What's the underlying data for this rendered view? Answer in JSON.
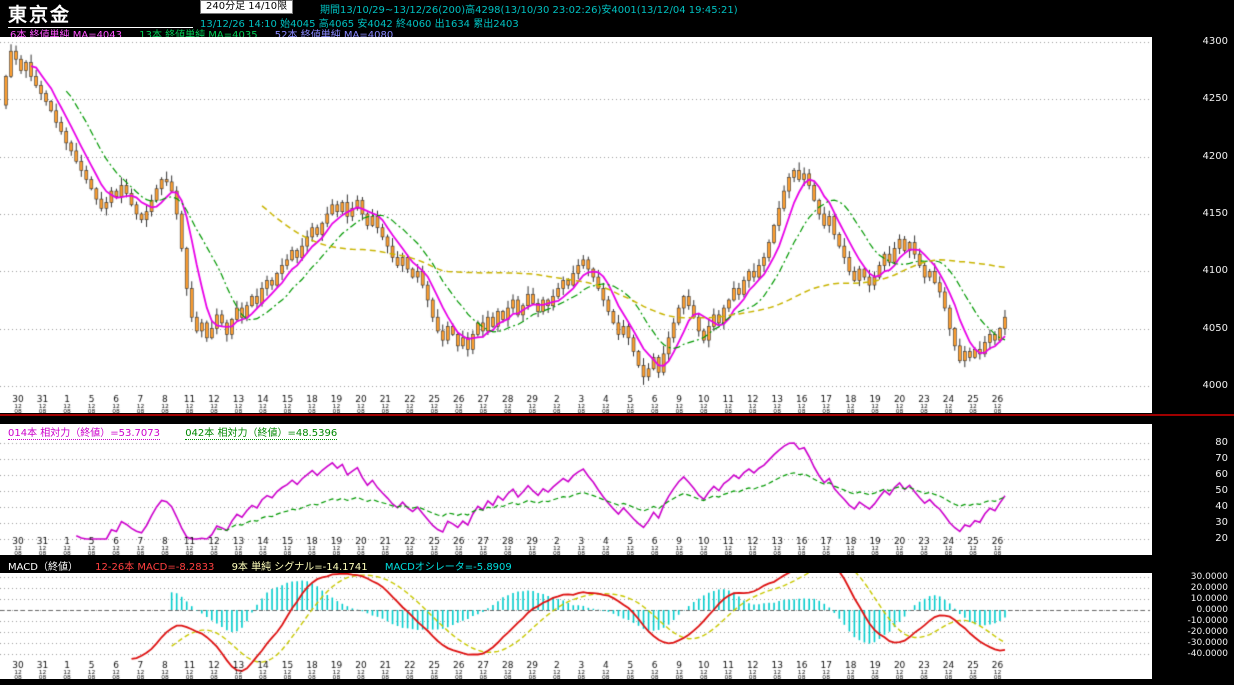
{
  "header": {
    "title": "東京金",
    "timeframe_box": "240分足 14/10限",
    "period_line": "期間13/10/29~13/12/26(200)高4298(13/10/30 23:02:26)安4001(13/12/04 19:45:21)",
    "quote_line": "13/12/26 14:10 始4045 高4065 安4042 終4060 出1634 累出2403",
    "ma_legend": [
      {
        "label": "6本 終値単純 MA=4043",
        "color": "#ff55ff"
      },
      {
        "label": "13本 終値単純 MA=4035",
        "color": "#00cc55"
      },
      {
        "label": "52本 終値単純 MA=4080",
        "color": "#8888ff"
      }
    ]
  },
  "rsi_header": [
    {
      "label": "014本 相対力（終値）=53.7073",
      "color": "#cc00cc"
    },
    {
      "label": "042本 相対力（終値）=48.5396",
      "color": "#008800"
    }
  ],
  "macd_header": {
    "title": "MACD（終値）",
    "items": [
      {
        "label": "12-26本 MACD=-8.2833",
        "color": "#ff4040"
      },
      {
        "label": "9本 単純 シグナル=-14.1741",
        "color": "#ffffbb"
      },
      {
        "label": "MACDオシレータ=-5.8909",
        "color": "#00dddd"
      }
    ]
  },
  "colors": {
    "background": "#000000",
    "panel_bg": "#ffffff",
    "teal_text": "#00c0c0",
    "grid": "#999999",
    "separator_red": "#a00000",
    "candle_fill": "#ffa030",
    "candle_border": "#333333",
    "ma_lines": [
      "#e800e8",
      "#009900",
      "#c8b400"
    ],
    "rsi_lines": [
      "#cc00cc",
      "#009900"
    ],
    "macd_line": "#dd1111",
    "macd_signal": "#c8c800",
    "macd_hist": "#00cccc",
    "axis_label": "#f0f0f0",
    "tick_label": "#111111"
  },
  "chart_data": {
    "type": "candlestick",
    "title": "東京金 240分足 14/10限",
    "panels": [
      {
        "name": "price",
        "type": "candlestick",
        "ylim": [
          4000,
          4300
        ],
        "ytick_step": 50,
        "ma_periods": [
          6,
          13,
          52
        ]
      },
      {
        "name": "rsi",
        "type": "line",
        "ylim": [
          20,
          80
        ],
        "ytick_step": 10,
        "periods": [
          14,
          42
        ]
      },
      {
        "name": "macd",
        "type": "line+histogram",
        "ylim": [
          -40,
          30
        ],
        "ytick_step": 10,
        "fast": 12,
        "slow": 26,
        "signal": 9
      }
    ],
    "first_open": 4245,
    "closes": [
      4270,
      4292,
      4285,
      4275,
      4282,
      4270,
      4262,
      4255,
      4248,
      4240,
      4230,
      4222,
      4212,
      4205,
      4196,
      4188,
      4180,
      4172,
      4163,
      4155,
      4160,
      4170,
      4165,
      4175,
      4168,
      4158,
      4150,
      4145,
      4152,
      4162,
      4172,
      4180,
      4178,
      4170,
      4150,
      4120,
      4085,
      4060,
      4048,
      4055,
      4042,
      4050,
      4062,
      4055,
      4045,
      4058,
      4068,
      4060,
      4070,
      4078,
      4072,
      4085,
      4092,
      4088,
      4098,
      4105,
      4110,
      4118,
      4112,
      4122,
      4130,
      4138,
      4132,
      4142,
      4150,
      4158,
      4152,
      4160,
      4148,
      4155,
      4162,
      4150,
      4140,
      4148,
      4138,
      4130,
      4122,
      4112,
      4105,
      4112,
      4102,
      4095,
      4100,
      4088,
      4075,
      4060,
      4048,
      4040,
      4052,
      4045,
      4035,
      4042,
      4032,
      4045,
      4055,
      4048,
      4060,
      4052,
      4065,
      4058,
      4068,
      4075,
      4062,
      4070,
      4080,
      4072,
      4065,
      4075,
      4070,
      4078,
      4085,
      4092,
      4088,
      4098,
      4105,
      4110,
      4102,
      4095,
      4085,
      4075,
      4065,
      4055,
      4045,
      4052,
      4042,
      4030,
      4018,
      4008,
      4015,
      4025,
      4012,
      4028,
      4042,
      4055,
      4068,
      4078,
      4070,
      4060,
      4048,
      4040,
      4052,
      4062,
      4055,
      4068,
      4075,
      4085,
      4080,
      4092,
      4100,
      4095,
      4105,
      4112,
      4125,
      4140,
      4155,
      4170,
      4182,
      4188,
      4180,
      4185,
      4175,
      4162,
      4150,
      4140,
      4148,
      4132,
      4122,
      4112,
      4100,
      4092,
      4102,
      4095,
      4088,
      4095,
      4105,
      4115,
      4108,
      4120,
      4128,
      4118,
      4125,
      4115,
      4105,
      4095,
      4100,
      4090,
      4082,
      4068,
      4050,
      4035,
      4022,
      4030,
      4025,
      4032,
      4028,
      4038,
      4045,
      4040,
      4050,
      4060
    ],
    "special_high": {
      "1": 4298
    },
    "special_low": {
      "127": 4001
    },
    "x_labels": [
      "30",
      "31",
      "1",
      "5",
      "6",
      "7",
      "8",
      "11",
      "12",
      "13",
      "14",
      "15",
      "18",
      "19",
      "20",
      "21",
      "22",
      "25",
      "26",
      "27",
      "28",
      "29",
      "2",
      "3",
      "4",
      "5",
      "6",
      "9",
      "10",
      "11",
      "12",
      "13",
      "16",
      "17",
      "18",
      "19",
      "20",
      "23",
      "24",
      "25",
      "26"
    ],
    "minor_tick": [
      "12",
      "08"
    ]
  }
}
